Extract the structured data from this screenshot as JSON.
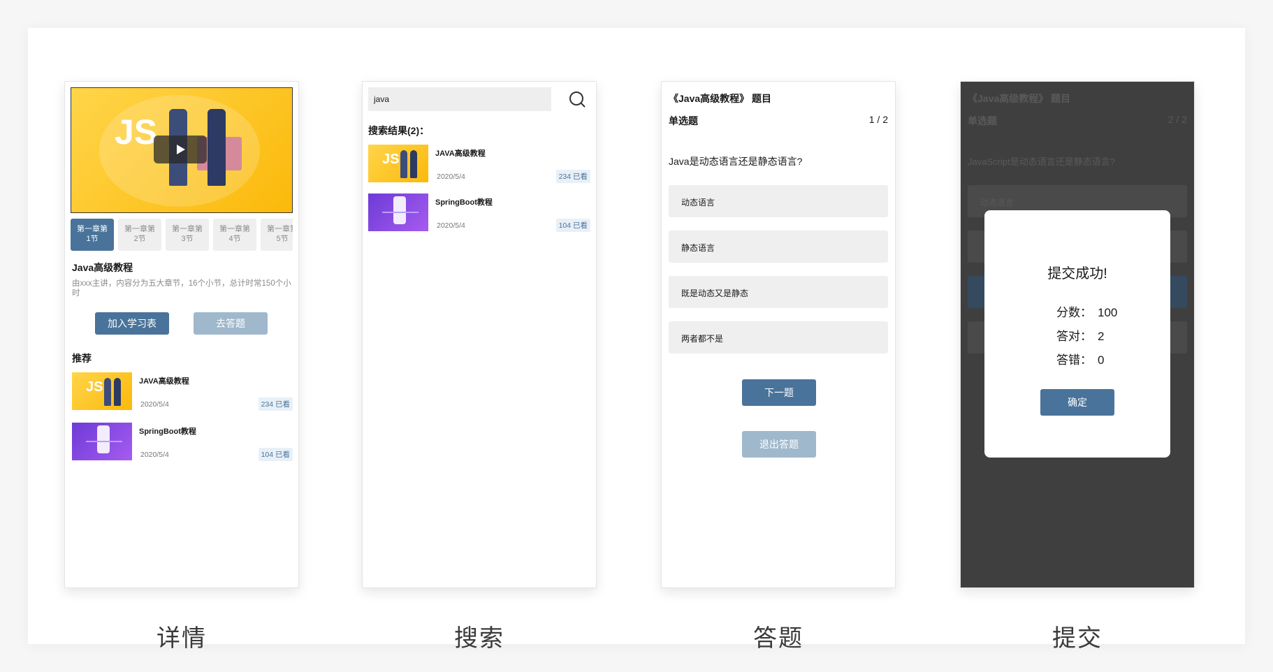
{
  "screens": {
    "detail": {
      "caption": "详情",
      "chapters": [
        "第一章第\n1节",
        "第一章第\n2节",
        "第一章第\n3节",
        "第一章第\n4节",
        "第一章第\n5节"
      ],
      "course_title": "Java高级教程",
      "course_desc": "由xxx主讲，内容分为五大章节，16个小节，总计时常150个小时",
      "add_button": "加入学习表",
      "quiz_button": "去答题",
      "recommend_title": "推荐",
      "recommendations": [
        {
          "title": "JAVA高级教程",
          "date": "2020/5/4",
          "views": "234 已看",
          "thumb": "js"
        },
        {
          "title": "SpringBoot教程",
          "date": "2020/5/4",
          "views": "104 已看",
          "thumb": "purple"
        }
      ],
      "hero_text": "JS"
    },
    "search": {
      "caption": "搜索",
      "query": "java",
      "results_title": "搜索结果(2)：",
      "results": [
        {
          "title": "JAVA高级教程",
          "date": "2020/5/4",
          "views": "234 已看",
          "thumb": "js"
        },
        {
          "title": "SpringBoot教程",
          "date": "2020/5/4",
          "views": "104 已看",
          "thumb": "purple"
        }
      ]
    },
    "quiz": {
      "caption": "答题",
      "title": "《Java高级教程》 题目",
      "type": "单选题",
      "progress": "1 / 2",
      "question": "Java是动态语言还是静态语言?",
      "options": [
        "动态语言",
        "静态语言",
        "既是动态又是静态",
        "两者都不是"
      ],
      "next_button": "下一题",
      "exit_button": "退出答题"
    },
    "submit": {
      "caption": "提交",
      "title": "《Java高级教程》 题目",
      "type": "单选题",
      "progress": "2 / 2",
      "question": "JavaScript是动态语言还是静态语言?",
      "first_option": "动态语言",
      "modal": {
        "title": "提交成功!",
        "score_label": "分数：",
        "score": "100",
        "correct_label": "答对：",
        "correct": "2",
        "wrong_label": "答错：",
        "wrong": "0",
        "confirm": "确定"
      }
    }
  },
  "colors": {
    "accent": "#49739a",
    "accent_light": "#9fb8cc",
    "overlay": "#3f3f3f"
  }
}
